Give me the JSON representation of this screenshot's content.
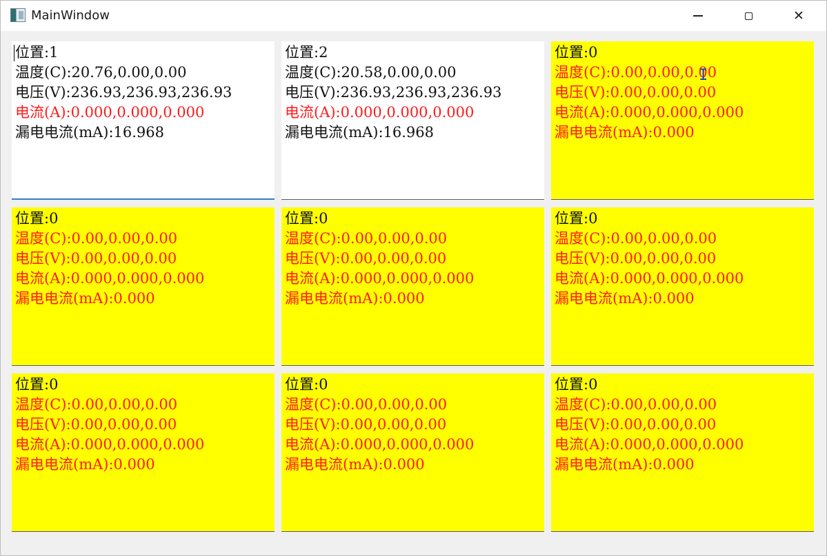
{
  "window": {
    "title": "MainWindow",
    "minimize_icon": "minimize-icon",
    "maximize_icon": "maximize-icon",
    "close_icon": "close-icon",
    "close_glyph": "✕"
  },
  "colors": {
    "panel_active_bg": "#ffffff",
    "panel_inactive_bg": "#ffff00",
    "text_normal": "#111111",
    "text_alert": "#ff1a1a",
    "focus_border": "#2f7fce"
  },
  "panels": [
    {
      "position": "位置:1",
      "temperature": "温度(C):20.76,0.00,0.00",
      "voltage": "电压(V):236.93,236.93,236.93",
      "current": "电流(A):0.000,0.000,0.000",
      "leakage": "漏电电流(mA):16.968"
    },
    {
      "position": "位置:2",
      "temperature": "温度(C):20.58,0.00,0.00",
      "voltage": "电压(V):236.93,236.93,236.93",
      "current": "电流(A):0.000,0.000,0.000",
      "leakage": "漏电电流(mA):16.968"
    },
    {
      "position": "位置:0",
      "temperature": "温度(C):0.00,0.00,0.00",
      "voltage": "电压(V):0.00,0.00,0.00",
      "current": "电流(A):0.000,0.000,0.000",
      "leakage": "漏电电流(mA):0.000"
    },
    {
      "position": "位置:0",
      "temperature": "温度(C):0.00,0.00,0.00",
      "voltage": "电压(V):0.00,0.00,0.00",
      "current": "电流(A):0.000,0.000,0.000",
      "leakage": "漏电电流(mA):0.000"
    },
    {
      "position": "位置:0",
      "temperature": "温度(C):0.00,0.00,0.00",
      "voltage": "电压(V):0.00,0.00,0.00",
      "current": "电流(A):0.000,0.000,0.000",
      "leakage": "漏电电流(mA):0.000"
    },
    {
      "position": "位置:0",
      "temperature": "温度(C):0.00,0.00,0.00",
      "voltage": "电压(V):0.00,0.00,0.00",
      "current": "电流(A):0.000,0.000,0.000",
      "leakage": "漏电电流(mA):0.000"
    },
    {
      "position": "位置:0",
      "temperature": "温度(C):0.00,0.00,0.00",
      "voltage": "电压(V):0.00,0.00,0.00",
      "current": "电流(A):0.000,0.000,0.000",
      "leakage": "漏电电流(mA):0.000"
    },
    {
      "position": "位置:0",
      "temperature": "温度(C):0.00,0.00,0.00",
      "voltage": "电压(V):0.00,0.00,0.00",
      "current": "电流(A):0.000,0.000,0.000",
      "leakage": "漏电电流(mA):0.000"
    },
    {
      "position": "位置:0",
      "temperature": "温度(C):0.00,0.00,0.00",
      "voltage": "电压(V):0.00,0.00,0.00",
      "current": "电流(A):0.000,0.000,0.000",
      "leakage": "漏电电流(mA):0.000"
    }
  ]
}
